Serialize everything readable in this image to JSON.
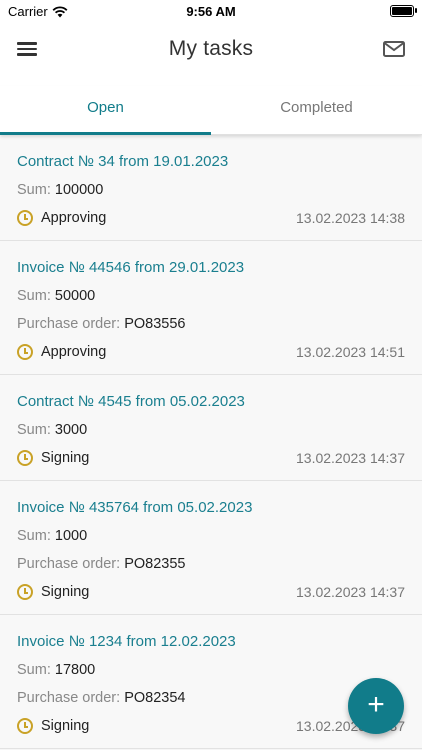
{
  "status_bar": {
    "carrier": "Carrier",
    "time": "9:56 AM",
    "battery_level": 0.9
  },
  "app_bar": {
    "title": "My tasks"
  },
  "tabs": [
    {
      "label": "Open",
      "active": true
    },
    {
      "label": "Completed",
      "active": false
    }
  ],
  "labels": {
    "sum": "Sum:",
    "purchase_order": "Purchase order:"
  },
  "tasks": [
    {
      "title": "Contract № 34 from 19.01.2023",
      "sum": "100000",
      "po": "",
      "status": "Approving",
      "date": "13.02.2023 14:38"
    },
    {
      "title": "Invoice № 44546 from 29.01.2023",
      "sum": "50000",
      "po": "PO83556",
      "status": "Approving",
      "date": "13.02.2023 14:51"
    },
    {
      "title": "Contract № 4545 from 05.02.2023",
      "sum": "3000",
      "po": "",
      "status": "Signing",
      "date": "13.02.2023 14:37"
    },
    {
      "title": "Invoice № 435764 from 05.02.2023",
      "sum": "1000",
      "po": "PO82355",
      "status": "Signing",
      "date": "13.02.2023 14:37"
    },
    {
      "title": "Invoice № 1234 from 12.02.2023",
      "sum": "17800",
      "po": "PO82354",
      "status": "Signing",
      "date": "13.02.2023 14:37"
    }
  ],
  "fab": {
    "label": "+"
  },
  "colors": {
    "accent": "#117c8a",
    "link": "#1a7f8f",
    "status_icon": "#c9a227"
  },
  "icons": {
    "menu": "hamburger-icon",
    "mail": "mail-icon",
    "status": "clock-icon",
    "fab": "plus-icon"
  }
}
